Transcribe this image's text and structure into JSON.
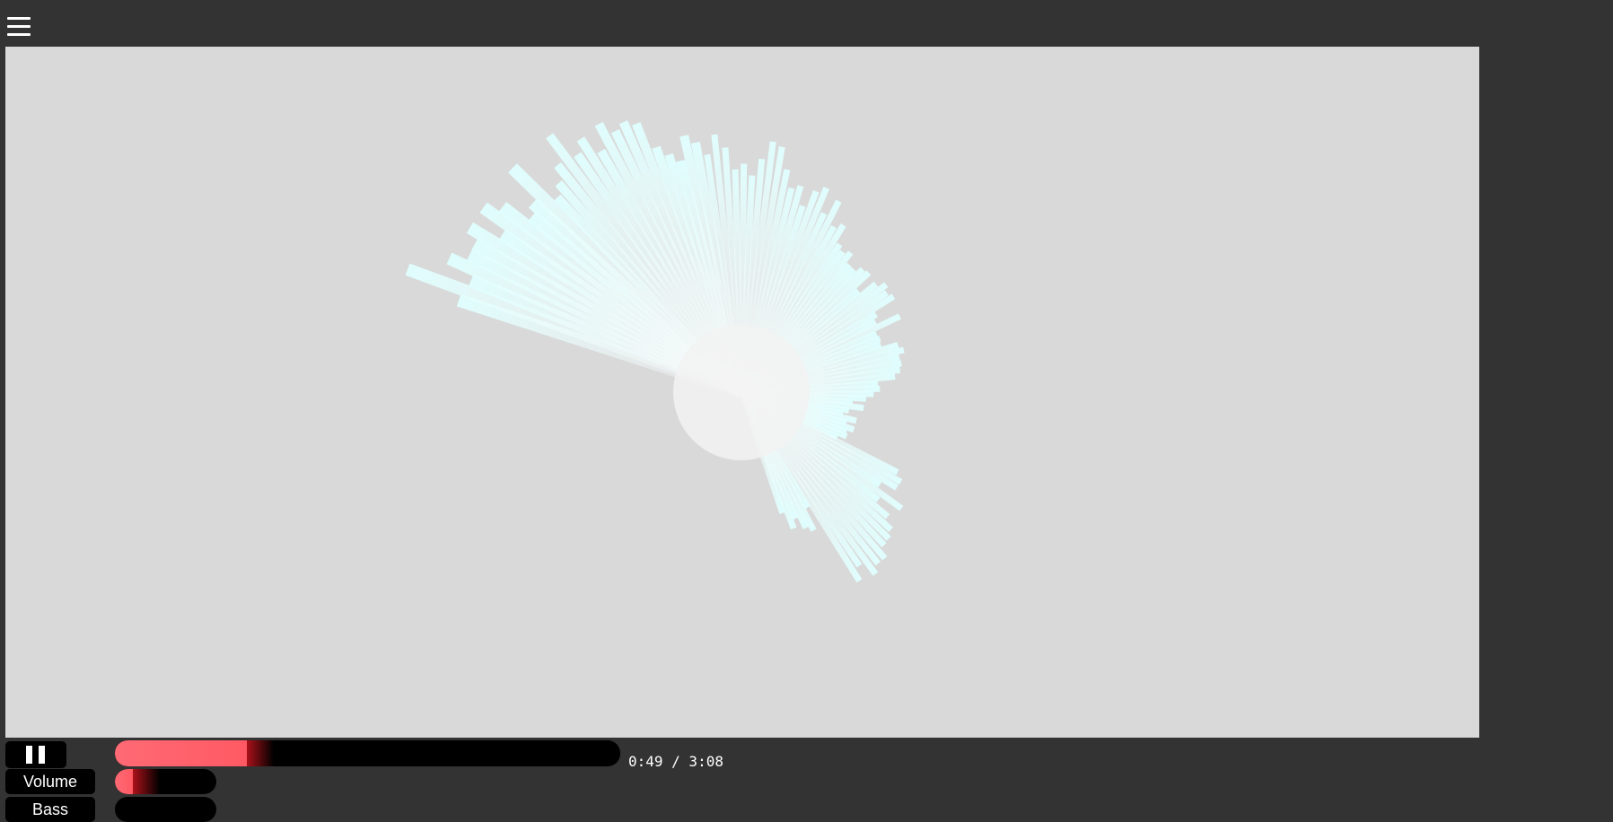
{
  "menu": {
    "icon": "hamburger-menu-icon"
  },
  "player": {
    "current_time": "0:49",
    "duration": "3:08",
    "time_display": "0:49 / 3:08",
    "progress_fraction": 0.261,
    "pause_icon": "pause-icon"
  },
  "volume": {
    "label": "Volume",
    "level_fraction": 0.18
  },
  "bass": {
    "label": "Bass",
    "level_fraction": 0.0
  },
  "visualizer": {
    "background": "#d9d9d9",
    "bar_color": "#e0ffff",
    "center_color": "#f2f2f2"
  },
  "colors": {
    "chrome": "#333333",
    "accent": "#ff5a64",
    "track": "#000000"
  }
}
